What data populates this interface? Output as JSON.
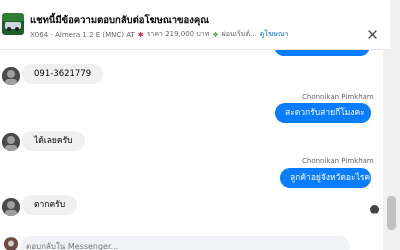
{
  "header": {
    "title": "แชทนี้มีข้อความตอบกลับต่อโฆษณาของคุณ",
    "listing": "X064 - Almera 1.2 E (MNC) AT",
    "price": "ราคา 219,000 บาท",
    "extra": "ผ่อนเริ่มต์...",
    "ad_link": "ดูโฆษณา",
    "close_icon": "close-icon"
  },
  "messages": [
    {
      "direction": "in",
      "text": "091-3621779"
    },
    {
      "direction": "out",
      "sender": "Chonnikan Pimkham",
      "text": "สะดวกรับสายกี่โมงคะ"
    },
    {
      "direction": "in",
      "text": "ได้เลยครับ"
    },
    {
      "direction": "out",
      "sender": "Chonnikan Pimkham",
      "text": "ลูกค้าอยู่จังหวัดอะไรคะ"
    },
    {
      "direction": "in",
      "text": "ตากครับ"
    }
  ],
  "composer": {
    "placeholder": "ตอบกลับใน Messenger..."
  },
  "colors": {
    "outgoing_bubble": "#0a7cff",
    "incoming_bubble": "#f0f0f0",
    "link": "#0a65d8"
  }
}
